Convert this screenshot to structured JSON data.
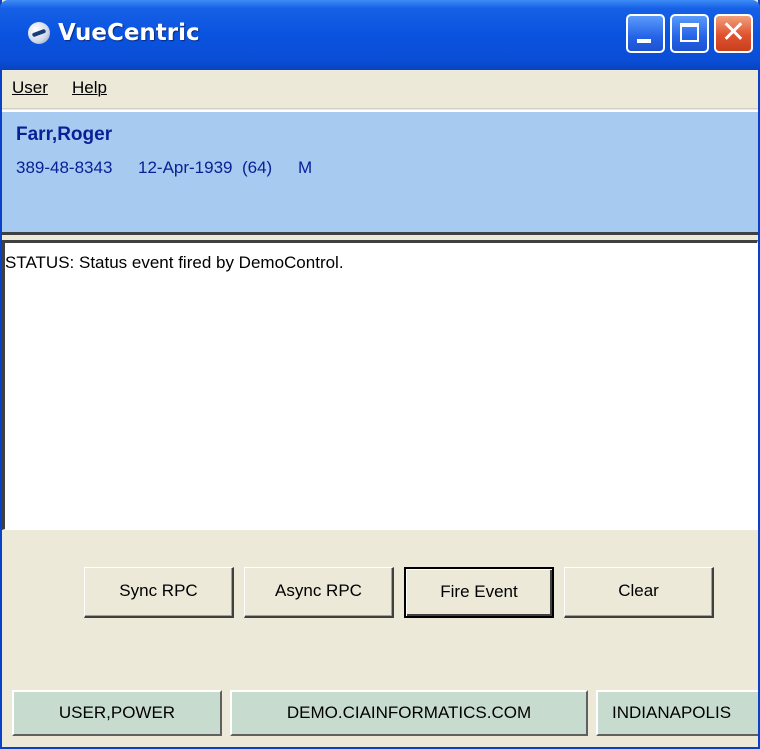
{
  "window": {
    "title": "VueCentric"
  },
  "menu": {
    "user": {
      "accel": "U",
      "rest": "ser"
    },
    "help": {
      "accel": "H",
      "rest": "elp"
    }
  },
  "patient": {
    "name": "Farr,Roger",
    "ssn": "389-48-8343",
    "dob_age": "12-Apr-1939  (64)",
    "sex": "M"
  },
  "log": {
    "text": "STATUS: Status event fired by DemoControl."
  },
  "buttons": {
    "sync": "Sync RPC",
    "async": "Async RPC",
    "fire": "Fire Event",
    "clear": "Clear"
  },
  "status": {
    "user": "USER,POWER",
    "server": "DEMO.CIAINFORMATICS.COM",
    "location": "INDIANAPOLIS"
  },
  "icons": {
    "app": "vuecentric-app-icon",
    "minimize": "minimize-icon",
    "maximize": "maximize-icon",
    "close": "close-icon"
  },
  "colors": {
    "titlebar": "#0a53e0",
    "patient_panel": "#a6caf0",
    "patient_text": "#0a1e96",
    "status_panel": "#c7dccf"
  }
}
